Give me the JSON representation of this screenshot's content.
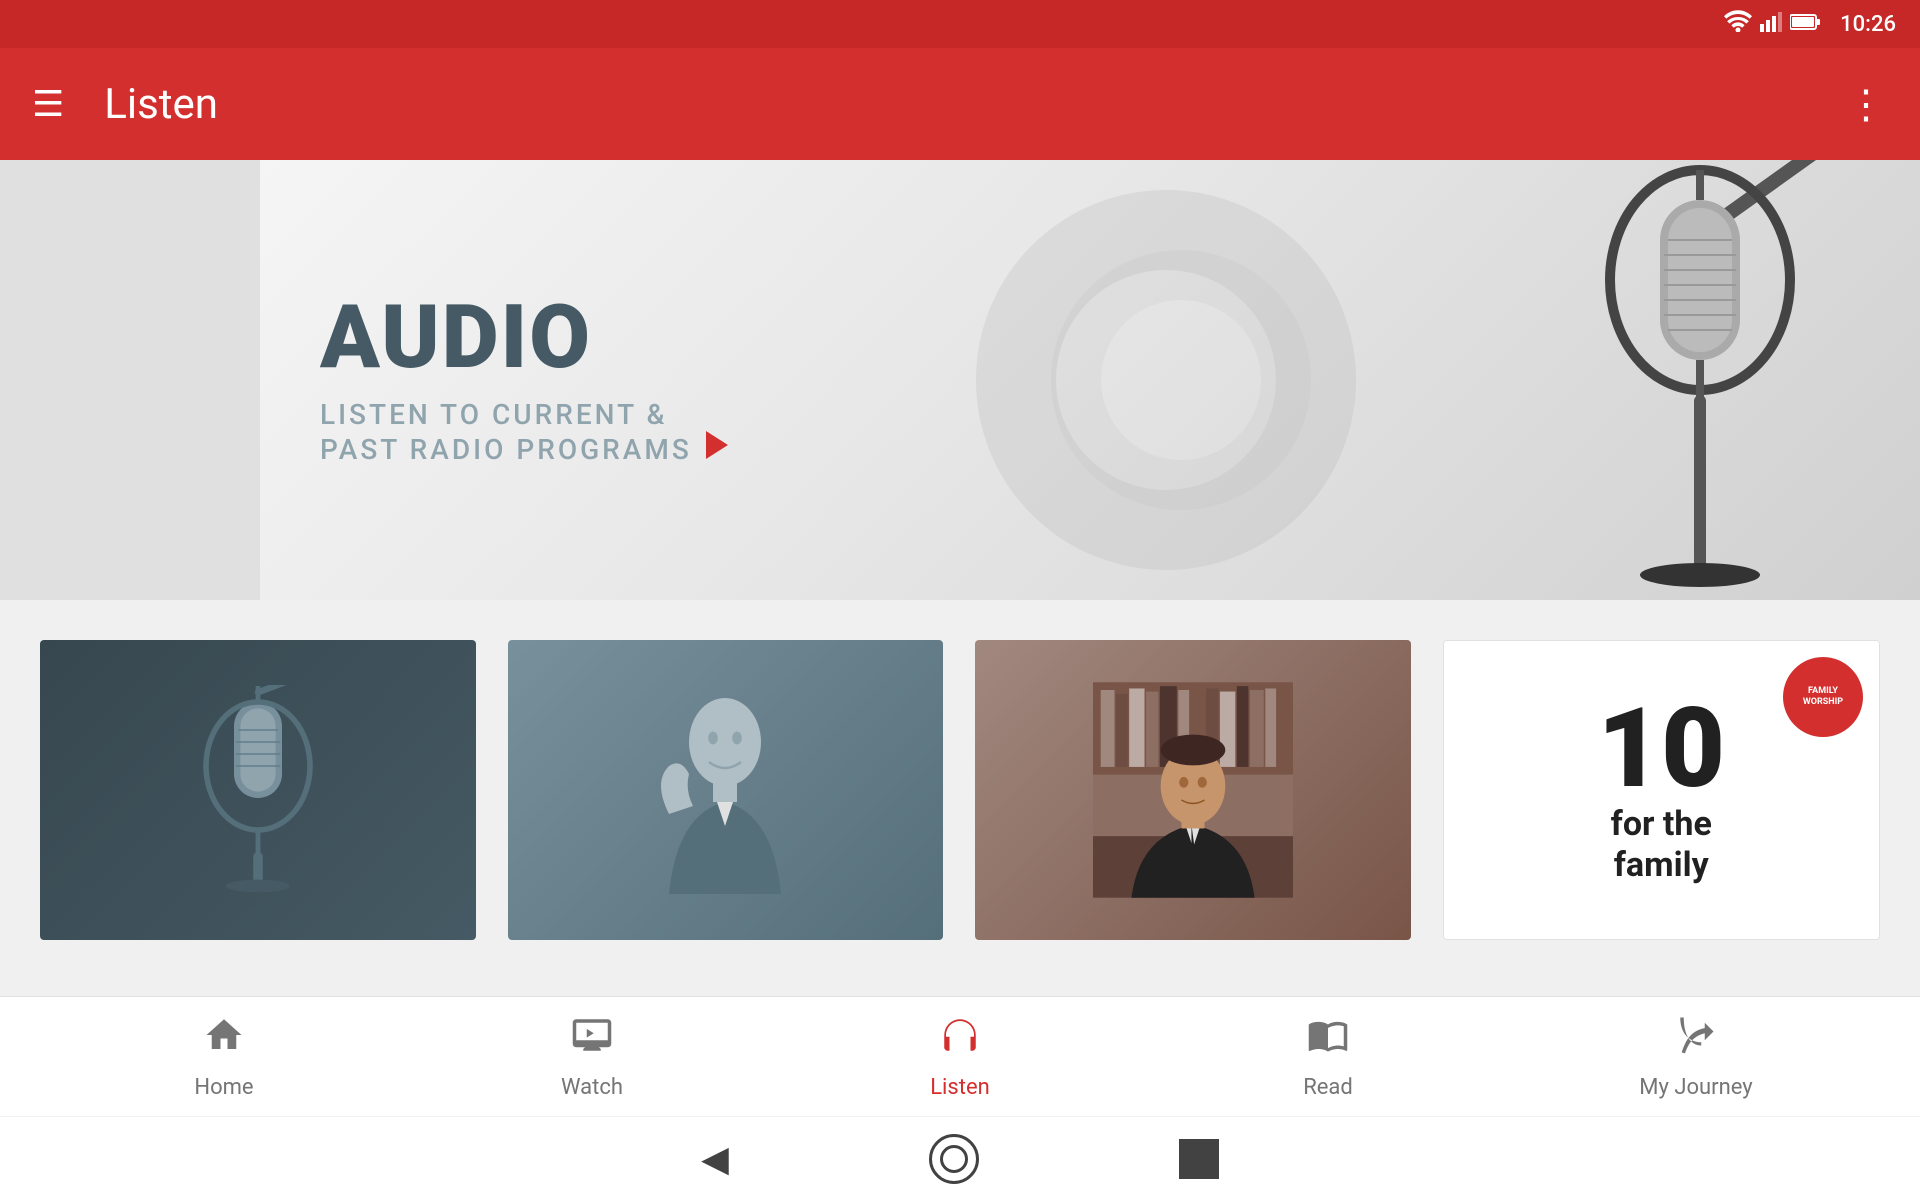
{
  "statusBar": {
    "time": "10:26",
    "wifiIcon": "wifi",
    "signalIcon": "signal",
    "batteryIcon": "battery"
  },
  "appBar": {
    "menuIcon": "☰",
    "title": "Listen",
    "moreIcon": "⋮"
  },
  "banner": {
    "audioTitle": "AUDIO",
    "subtitle": "LISTEN TO CURRENT &",
    "subtitle2": "PAST RADIO PROGRAMS"
  },
  "cards": [
    {
      "id": "card-mic",
      "type": "mic"
    },
    {
      "id": "card-person",
      "type": "person"
    },
    {
      "id": "card-portrait",
      "type": "portrait"
    },
    {
      "id": "card-family",
      "type": "family",
      "number": "10",
      "label": "for the\nfamily"
    }
  ],
  "bottomNav": {
    "items": [
      {
        "id": "home",
        "icon": "🏠",
        "label": "Home",
        "active": false
      },
      {
        "id": "watch",
        "icon": "▶",
        "label": "Watch",
        "active": false
      },
      {
        "id": "listen",
        "icon": "🎧",
        "label": "Listen",
        "active": true
      },
      {
        "id": "read",
        "icon": "📖",
        "label": "Read",
        "active": false
      },
      {
        "id": "myjourney",
        "icon": "🌿",
        "label": "My Journey",
        "active": false
      }
    ]
  }
}
